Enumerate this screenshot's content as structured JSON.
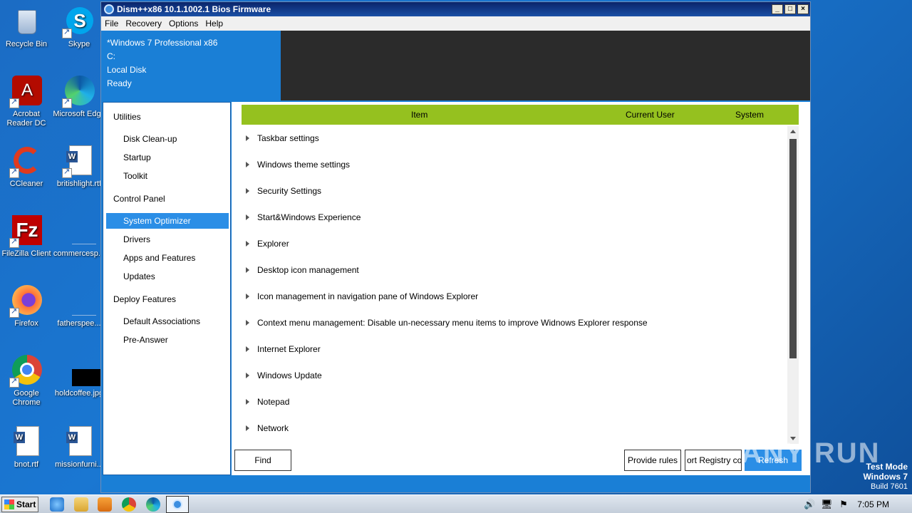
{
  "desktop": {
    "icons": [
      {
        "label": "Recycle Bin"
      },
      {
        "label": "Skype"
      },
      {
        "label": "Acrobat Reader DC"
      },
      {
        "label": "Microsoft Edge"
      },
      {
        "label": "CCleaner"
      },
      {
        "label": "britishlight.rtf"
      },
      {
        "label": "FileZilla Client"
      },
      {
        "label": "commercesp..."
      },
      {
        "label": "Firefox"
      },
      {
        "label": "fatherspee..."
      },
      {
        "label": "Google Chrome"
      },
      {
        "label": "holdcoffee.jpg"
      },
      {
        "label": "bnot.rtf"
      },
      {
        "label": "missionfurni..."
      }
    ]
  },
  "window": {
    "title": "Dism++x86 10.1.1002.1 Bios Firmware",
    "buttons": {
      "minimize": "_",
      "maximize": "□",
      "close": "×"
    },
    "menu": [
      "File",
      "Recovery",
      "Options",
      "Help"
    ]
  },
  "info": {
    "os": "*Windows 7 Professional x86",
    "drive": "C:",
    "disk": "Local Disk",
    "status": "Ready"
  },
  "sidebar": {
    "groups": [
      {
        "label": "Utilities",
        "items": [
          "Disk Clean-up",
          "Startup",
          "Toolkit"
        ]
      },
      {
        "label": "Control Panel",
        "items": [
          "System Optimizer",
          "Drivers",
          "Apps and Features",
          "Updates"
        ]
      },
      {
        "label": "Deploy Features",
        "items": [
          "Default Associations",
          "Pre-Answer"
        ]
      }
    ],
    "selected": "System Optimizer"
  },
  "table": {
    "headers": {
      "item": "Item",
      "current_user": "Current User",
      "system": "System"
    },
    "rows": [
      "Taskbar settings",
      "Windows theme settings",
      "Security Settings",
      "Start&Windows Experience",
      "Explorer",
      "Desktop icon management",
      "Icon management in navigation pane of Windows Explorer",
      "Context menu management: Disable un-necessary menu items to improve Widnows Explorer response",
      "Internet Explorer",
      "Windows Update",
      "Notepad",
      "Network"
    ]
  },
  "buttons": {
    "find": "Find",
    "provide_rules": "Provide rules",
    "import_registry": "ort Registry co",
    "refresh": "Refresh"
  },
  "taskbar": {
    "start_label": "Start",
    "clock": "7:05 PM"
  },
  "overlay": {
    "watermark": "ANY RUN",
    "test_mode": "Test Mode",
    "os_name": "Windows 7",
    "build": "Build 7601"
  },
  "colors": {
    "accent_blue": "#2b8ee6",
    "header_green": "#95c11f",
    "info_dark": "#2b2b2b"
  }
}
